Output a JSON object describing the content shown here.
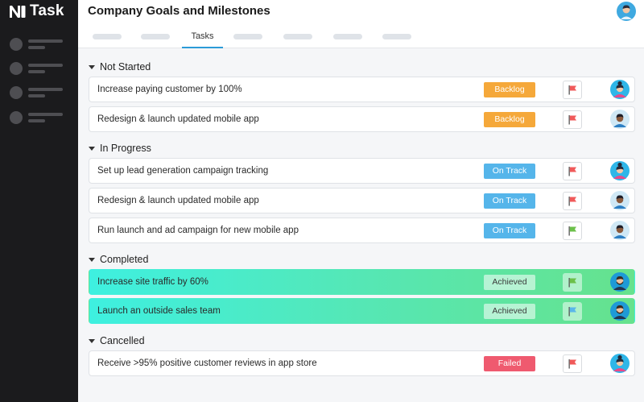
{
  "app": {
    "name": "Task"
  },
  "header": {
    "title": "Company Goals and Milestones",
    "active_tab": "Tasks"
  },
  "colors": {
    "sidebar_bg": "#1b1b1d",
    "accent": "#2b9bd8",
    "backlog": "#f5a83a",
    "on_track": "#55b5ea",
    "failed": "#ef5a6f",
    "achieved_gradient": [
      "#3ef0e0",
      "#66e28d"
    ],
    "flag_red": "#f05a5a",
    "flag_green": "#6cc04a",
    "flag_blue": "#5ab7ea"
  },
  "sections": [
    {
      "label": "Not Started",
      "rows": [
        {
          "title": "Increase paying customer by 100%",
          "status": "Backlog",
          "flag": "red-flag-icon",
          "avatar": "woman-avatar-icon"
        },
        {
          "title": "Redesign & launch updated mobile app",
          "status": "Backlog",
          "flag": "red-flag-icon",
          "avatar": "man-avatar-icon"
        }
      ]
    },
    {
      "label": "In Progress",
      "rows": [
        {
          "title": "Set up lead generation campaign tracking",
          "status": "On Track",
          "flag": "red-flag-icon",
          "avatar": "woman-avatar-icon"
        },
        {
          "title": "Redesign & launch updated mobile app",
          "status": "On Track",
          "flag": "red-flag-icon",
          "avatar": "man-avatar-icon"
        },
        {
          "title": "Run launch and ad campaign for new mobile app",
          "status": "On Track",
          "flag": "green-flag-icon",
          "avatar": "man-avatar-icon"
        }
      ]
    },
    {
      "label": "Completed",
      "rows": [
        {
          "title": "Increase site traffic by 60%",
          "status": "Achieved",
          "flag": "green-flag-icon",
          "avatar": "bearded-man-avatar-icon"
        },
        {
          "title": "Launch an outside sales team",
          "status": "Achieved",
          "flag": "blue-flag-icon",
          "avatar": "bearded-man-avatar-icon"
        }
      ]
    },
    {
      "label": "Cancelled",
      "rows": [
        {
          "title": "Receive >95% positive customer reviews in app store",
          "status": "Failed",
          "flag": "red-flag-icon",
          "avatar": "woman-avatar-icon"
        }
      ]
    }
  ]
}
